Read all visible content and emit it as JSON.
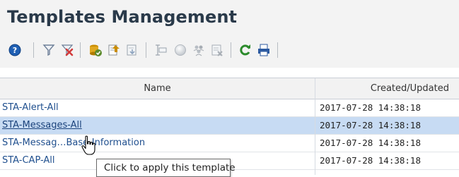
{
  "page": {
    "title": "Templates Management"
  },
  "toolbar": {
    "icons": [
      {
        "name": "help-icon",
        "color": "#1f5fb3"
      },
      {
        "name": "filter-icon",
        "color": "#6d7f98"
      },
      {
        "name": "clear-filter-icon",
        "color": "#d23b3b"
      },
      {
        "name": "apply-template-icon",
        "color": "#5c8a2b"
      },
      {
        "name": "export-template-icon",
        "color": "#c98c00"
      },
      {
        "name": "import-template-icon",
        "color": "#9aa3ad"
      },
      {
        "name": "properties-icon",
        "color": "#9aa3ad"
      },
      {
        "name": "status-circle-icon",
        "color": "#cfd3d8"
      },
      {
        "name": "people-icon",
        "color": "#a7adb4"
      },
      {
        "name": "delete-template-icon",
        "color": "#a7adb4"
      },
      {
        "name": "refresh-icon",
        "color": "#2b8a2b"
      },
      {
        "name": "print-icon",
        "color": "#2c5aa0"
      }
    ]
  },
  "table": {
    "columns": [
      "Name",
      "Created/Updated"
    ],
    "rows": [
      {
        "name": "STA-Alert-All",
        "date": "2017-07-28 14:38:18",
        "selected": false
      },
      {
        "name": "STA-Messages-All",
        "date": "2017-07-28 14:38:18",
        "selected": true
      },
      {
        "name": "STA-Messag…Base-Information",
        "date": "2017-07-28 14:38:18",
        "selected": false
      },
      {
        "name": "STA-CAP-All",
        "date": "2017-07-28 14:38:18",
        "selected": false
      }
    ]
  },
  "tooltip": {
    "text": "Click to apply this template"
  },
  "colors": {
    "link": "#1f4f8e",
    "selected_row": "#c7dbf3",
    "title": "#2a3a4a"
  }
}
